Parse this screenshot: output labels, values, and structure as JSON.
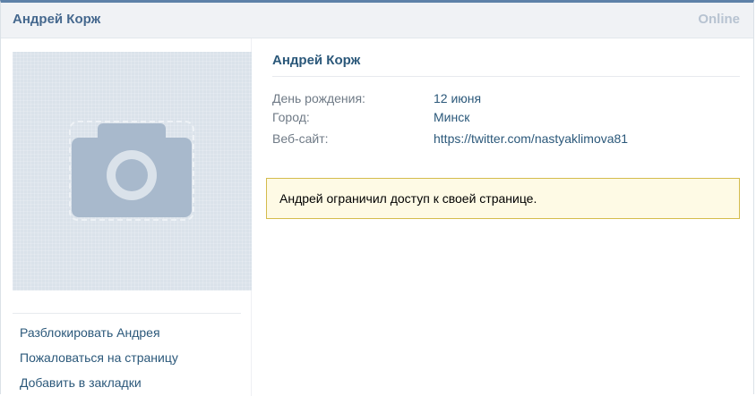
{
  "header": {
    "title": "Андрей Корж",
    "status": "Online"
  },
  "profile": {
    "name": "Андрей Корж",
    "avatar_placeholder_icon": "camera-icon",
    "info": [
      {
        "label": "День рождения:",
        "value": "12 июня"
      },
      {
        "label": "Город:",
        "value": "Минск"
      },
      {
        "label": "Веб-сайт:",
        "value": "https://twitter.com/nastyaklimova81"
      }
    ]
  },
  "notice": {
    "text": "Андрей ограничил доступ к своей странице."
  },
  "actions": [
    {
      "label": "Разблокировать Андрея"
    },
    {
      "label": "Пожаловаться на страницу"
    },
    {
      "label": "Добавить в закладки"
    }
  ],
  "colors": {
    "accent": "#5e81a8",
    "link": "#2b587a",
    "header_bg": "#f0f2f5",
    "notice_bg": "#fefae5",
    "notice_border": "#d4bc4c"
  }
}
